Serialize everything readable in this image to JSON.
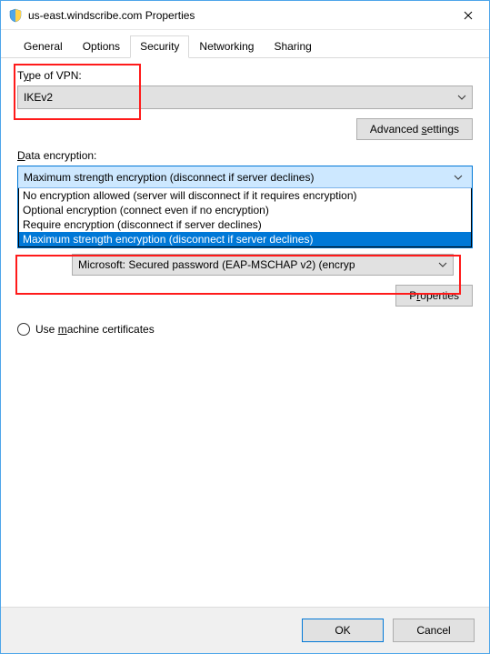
{
  "titlebar": {
    "title": "us-east.windscribe.com Properties"
  },
  "tabs": {
    "items": [
      {
        "label": "General"
      },
      {
        "label": "Options"
      },
      {
        "label": "Security"
      },
      {
        "label": "Networking"
      },
      {
        "label": "Sharing"
      }
    ]
  },
  "vpn_type": {
    "label_pre": "T",
    "label_u": "y",
    "label_post": "pe of VPN:",
    "value": "IKEv2"
  },
  "advanced_btn": {
    "pre": "Advanced ",
    "u": "s",
    "post": "ettings"
  },
  "data_encryption": {
    "label_u": "D",
    "label_post": "ata encryption:",
    "selected": "Maximum strength encryption (disconnect if server declines)",
    "options": [
      "No encryption allowed (server will disconnect if it requires encryption)",
      "Optional encryption (connect even if no encryption)",
      "Require encryption (disconnect if server declines)",
      "Maximum strength encryption (disconnect if server declines)"
    ]
  },
  "eap_combo": {
    "value": "Microsoft: Secured password (EAP-MSCHAP v2) (encryp"
  },
  "properties_btn": {
    "pre": "P",
    "u": "r",
    "post": "operties"
  },
  "radio_machine": {
    "pre": "Use ",
    "u": "m",
    "post": "achine certificates"
  },
  "footer": {
    "ok": "OK",
    "cancel": "Cancel"
  }
}
